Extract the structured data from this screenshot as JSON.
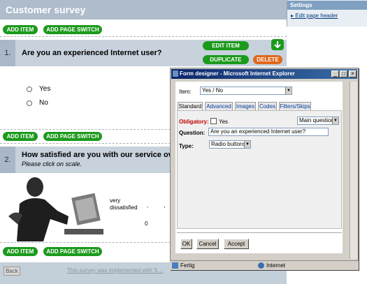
{
  "page": {
    "title": "Customer survey",
    "add_item": "ADD ITEM",
    "add_page_switch": "ADD PAGE SWITCH",
    "edit_item": "EDIT ITEM",
    "duplicate": "DUPLICATE",
    "delete": "DELETE",
    "back": "Back",
    "footer_text": "This survey was implemented with S…"
  },
  "questions": [
    {
      "num": "1.",
      "text": "Are you an experienced Internet user?",
      "options": [
        "Yes",
        "No"
      ]
    },
    {
      "num": "2.",
      "text": "How satisfied are you with our service overa",
      "hint": "Please click on scale.",
      "scale_label_1": "very",
      "scale_label_2": "dissatisfied",
      "scale_zero": "0",
      "scale_ticks": ", ,"
    }
  ],
  "settings": {
    "title": "Settings",
    "link": "Edit page header"
  },
  "dialog": {
    "title": "Form designer - Microsoft Internet Explorer",
    "item_label": "Item:",
    "item_value": "Yes / No",
    "tabs": [
      "Standard",
      "Advanced",
      "Images",
      "Codes",
      "Filters/Skips"
    ],
    "obligatory_label": "Obligatory:",
    "obligatory_value": "Yes",
    "main_question": "Main question",
    "question_label": "Question:",
    "question_value": "Are you an experienced Internet user?",
    "type_label": "Type:",
    "type_value": "Radio buttons",
    "ok": "OK",
    "cancel": "Cancel",
    "accept": "Accept",
    "status_done": "Fertig",
    "status_zone": "Internet"
  }
}
